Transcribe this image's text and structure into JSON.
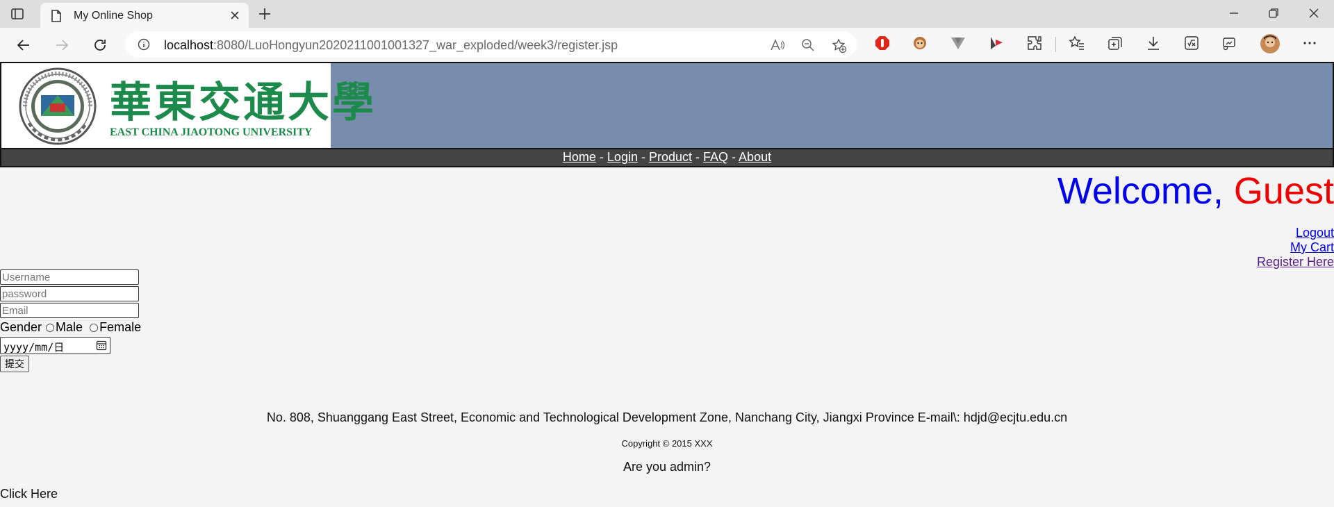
{
  "browser": {
    "tab_title": "My Online Shop",
    "url_host": "localhost",
    "url_rest": ":8080/LuoHongyun2020211001001327_war_exploded/week3/register.jsp"
  },
  "banner": {
    "logo_cn": "華東交通大學",
    "logo_en": "EAST CHINA JIAOTONG UNIVERSITY",
    "bg_color": "#788cad"
  },
  "nav": {
    "items": [
      "Home",
      "Login",
      "Product",
      "FAQ",
      "About"
    ],
    "separator": " - "
  },
  "welcome": {
    "prefix": "Welcome, ",
    "name": "Guest"
  },
  "user_links": {
    "logout": "Logout",
    "cart": "My Cart",
    "register": "Register Here"
  },
  "form": {
    "username_placeholder": "Username",
    "password_placeholder": "password",
    "email_placeholder": "Email",
    "gender_label": "Gender",
    "male_label": "Male",
    "female_label": "Female",
    "date_placeholder": "yyyy/mm/日",
    "submit_label": "提交"
  },
  "footer": {
    "address": "No. 808, Shuanggang East Street, Economic and Technological Development Zone, Nanchang City, Jiangxi Province E-mail\\: hdjd@ecjtu.edu.cn",
    "copyright": "Copyright © 2015 XXX",
    "admin_question": "Are you admin?",
    "click_here": "Click Here"
  }
}
